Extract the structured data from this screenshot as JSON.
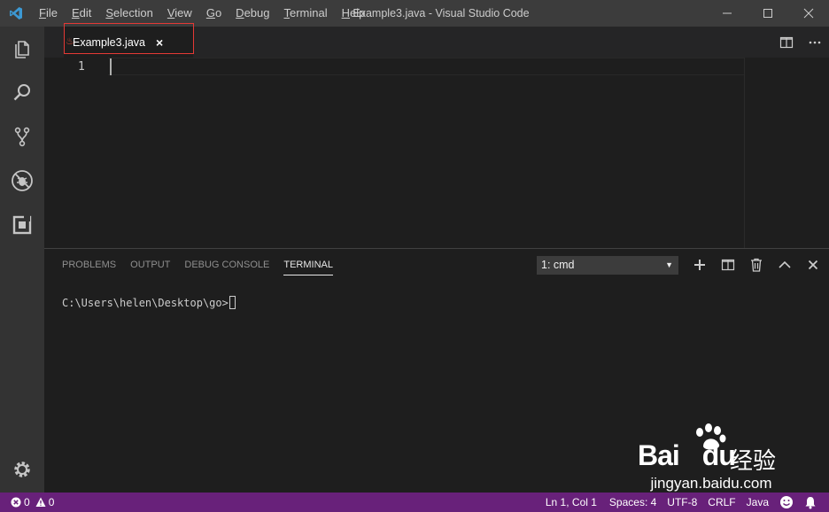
{
  "window": {
    "title": "Example3.java - Visual Studio Code"
  },
  "menu": [
    {
      "prefix": "",
      "mnemonic": "F",
      "rest": "ile"
    },
    {
      "prefix": "",
      "mnemonic": "E",
      "rest": "dit"
    },
    {
      "prefix": "",
      "mnemonic": "S",
      "rest": "election"
    },
    {
      "prefix": "",
      "mnemonic": "V",
      "rest": "iew"
    },
    {
      "prefix": "",
      "mnemonic": "G",
      "rest": "o"
    },
    {
      "prefix": "",
      "mnemonic": "D",
      "rest": "ebug"
    },
    {
      "prefix": "",
      "mnemonic": "T",
      "rest": "erminal"
    },
    {
      "prefix": "",
      "mnemonic": "H",
      "rest": "elp"
    }
  ],
  "editor": {
    "tab": {
      "label": "Example3.java",
      "close": "×",
      "file_icon": "java-icon"
    },
    "line_numbers": [
      "1"
    ]
  },
  "panel": {
    "tabs": [
      "PROBLEMS",
      "OUTPUT",
      "DEBUG CONSOLE",
      "TERMINAL"
    ],
    "active_tab": "TERMINAL",
    "terminal_select": "1: cmd",
    "terminal_prompt": "C:\\Users\\helen\\Desktop\\go>"
  },
  "statusbar": {
    "errors": "0",
    "warnings": "0",
    "position": "Ln 1, Col 1",
    "spaces": "Spaces: 4",
    "encoding": "UTF-8",
    "eol": "CRLF",
    "language": "Java"
  },
  "watermark": {
    "brand": "Bai",
    "brand2": "du",
    "cn": "经验",
    "url": "jingyan.baidu.com"
  },
  "colors": {
    "statusbar": "#68217a",
    "activitybar": "#333333",
    "titlebar": "#3c3c3c",
    "highlight": "#e53935"
  }
}
